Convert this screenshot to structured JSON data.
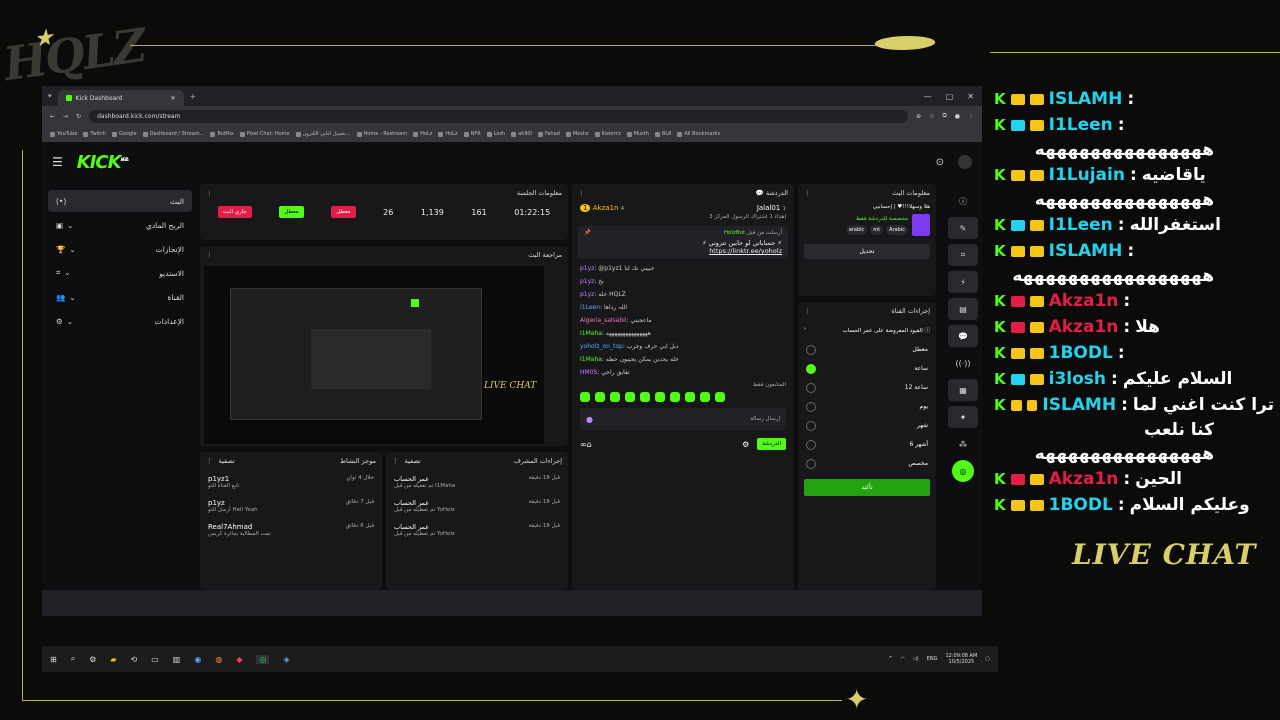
{
  "overlay": {
    "logo_text": "HQLZ",
    "live_chat_label": "LIVE CHAT",
    "accent": "#d8cf6a"
  },
  "browser": {
    "tab_title": "Kick Dashboard",
    "url": "dashboard.kick.com/stream",
    "bookmarks": [
      "YouTube",
      "Twitch",
      "Google",
      "Dashboard / Stream...",
      "BotRix",
      "Pixel Chat: Home",
      "تحميل اغاني الكترون...",
      "Home - Restream",
      "HoLz",
      "HoLz",
      "NFR",
      "Lozh",
      "ak90l",
      "Fahad",
      "Meshz",
      "Kwerrrz",
      "Musth",
      "BL8",
      "All Bookmarks"
    ]
  },
  "kick": {
    "logo": "KICK",
    "logo_tag": "BETA",
    "sidebar": [
      {
        "label": "البث",
        "icon": "(•)"
      },
      {
        "label": "الربح المادي",
        "icon": "▣"
      },
      {
        "label": "الإنجازات",
        "icon": "🏆"
      },
      {
        "label": "الاستديو",
        "icon": "⌗"
      },
      {
        "label": "القناة",
        "icon": "👥"
      },
      {
        "label": "الإعدادات",
        "icon": "⚙"
      }
    ],
    "session": {
      "title": "معلومات الجلسة",
      "live_button": "جاري البث",
      "mode_button": "معطل",
      "offline_button": "معطل",
      "viewers": "26",
      "followers": "1,139",
      "subs": "161",
      "uptime": "01:22:15"
    },
    "preview_title": "مراجعة البث",
    "chat": {
      "title": "الدردشة",
      "top_user": "Akza1n",
      "top_count": "1",
      "sub_count": "4",
      "second_user": "Jalal01",
      "second_count": "1",
      "gift_line": "إهداء 1 اشتراك الرسول المركز 3",
      "pinned_label": "أرسلت من قبل",
      "pinned_user": "HolzBot",
      "pinned_msg": "⚡ حساباتي لو حابين تتروني ⚡",
      "pinned_link": "https://linktr.ee/yoholz",
      "messages": [
        {
          "user": "p1yz",
          "text": "@p1yz1 حبيبي نك لنا"
        },
        {
          "user": "p1yz",
          "text": "بخ"
        },
        {
          "user": "p1yz",
          "text": "خله HQLZ"
        },
        {
          "user": "I1Leen",
          "text": "اللہ رداها"
        },
        {
          "user": "Algeria_salsabil",
          "text": "ماعجبني"
        },
        {
          "user": "I1Maha",
          "text": "هههههههههههههههه"
        },
        {
          "user": "yoholz_on_top",
          "text": "دبل ابي حرف وجرب"
        },
        {
          "user": "I1Maha",
          "text": "خله يحدين يمكن يجيبون حظه"
        },
        {
          "user": "HM0S",
          "text": "تفايق راجي"
        }
      ],
      "emotes_label": "المتابعون فقط",
      "input_placeholder": "إرسال رسالة",
      "send_button": "الدردشة"
    },
    "stream_info": {
      "title": "معلومات البث",
      "stream_title": "هلا وسهلا!!!♥ | إحسانيي",
      "category": "مخصصة للدردشة فقط",
      "tags": [
        "Arabic",
        "mt",
        "arabic"
      ],
      "edit_button": "تحديل"
    },
    "channel_actions": {
      "title": "إجراءات القناة",
      "sub_title": "القيود المفروضة على عمر الحساب",
      "options": [
        "معطل",
        "ساعة",
        "12 ساعة",
        "يوم",
        "شهر",
        "6 أشهر",
        "مخصص"
      ],
      "selected_index": 1,
      "confirm_button": "تأكيد"
    },
    "activity": {
      "title": "موجز النشاط",
      "filter": "تصفية",
      "items": [
        {
          "user": "p1yz1",
          "text": "تابع القناة للتو",
          "time": "خلال 4 ثوانٍ"
        },
        {
          "user": "p1yz",
          "text": "أرسل للتو Hell Yeah",
          "time": "قبل 7 دقائق"
        },
        {
          "user": "Real7Ahmad",
          "text": "تمت المطالبة بجائزة كريس",
          "time": "قبل 6 دقائق"
        }
      ]
    },
    "mod_actions": {
      "title": "إجراءات المشرف",
      "filter": "تصفية",
      "items": [
        {
          "action": "عمر الحساب",
          "text": "تم تفعيله من قبل I1Maha",
          "time": "قبل 18 دقيقة"
        },
        {
          "action": "عمر الحساب",
          "text": "تم تعطيله من قبل YoHolz",
          "time": "قبل 18 دقيقة"
        },
        {
          "action": "عمر الحساب",
          "text": "تم تعطيله من قبل YoHolz",
          "time": "قبل 18 دقيقة"
        }
      ]
    }
  },
  "taskbar": {
    "lang": "ENG",
    "time": "12:09:08 AM",
    "date": "10/5/2025"
  },
  "overlay_chat": [
    {
      "user": "ISLAMH",
      "msg": "",
      "badge": "#f5c518"
    },
    {
      "user": "I1Leen",
      "msg": "",
      "badge": "#22d3ee"
    },
    {
      "text": "هههههههههههههههه"
    },
    {
      "user": "I1Lujain",
      "msg": "ياقاضيه",
      "badge": "#f5c518"
    },
    {
      "text": "هههههههههههههههه"
    },
    {
      "user": "I1Leen",
      "msg": "استغفرالله",
      "badge": "#22d3ee"
    },
    {
      "user": "ISLAMH",
      "msg": "",
      "badge": "#f5c518"
    },
    {
      "text": "هههههههههههههههههه"
    },
    {
      "user": "Akza1n",
      "msg": "",
      "badge": "#e11d48",
      "red": true
    },
    {
      "user": "Akza1n",
      "msg": "هلا",
      "badge": "#e11d48",
      "red": true
    },
    {
      "user": "1BODL",
      "msg": "",
      "badge": "#f5c518"
    },
    {
      "user": "i3losh",
      "msg": "السلام عليكم",
      "badge": "#22d3ee"
    },
    {
      "user": "ISLAMH",
      "msg": "ترا كنت اغني لما",
      "badge": "#f5c518"
    },
    {
      "text": "كنا نلعب"
    },
    {
      "text": "هههههههههههههههه"
    },
    {
      "user": "Akza1n",
      "msg": "الحين",
      "badge": "#e11d48",
      "red": true
    },
    {
      "user": "1BODL",
      "msg": "وعليكم السلام",
      "badge": "#f5c518"
    }
  ]
}
